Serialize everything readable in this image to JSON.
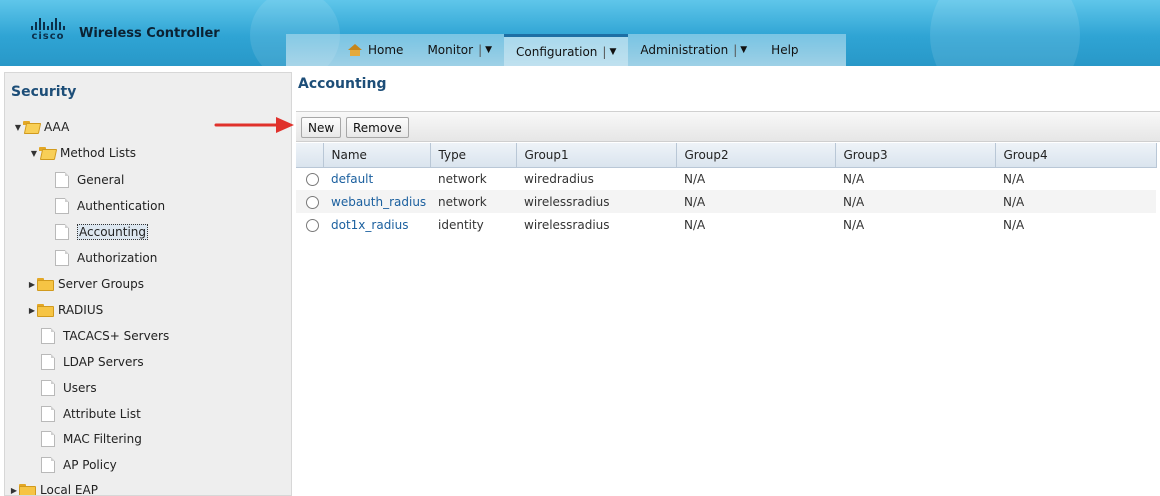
{
  "header": {
    "logo_text": "cisco",
    "product_name": "Wireless Controller",
    "nav": [
      {
        "label": "Home",
        "has_menu": false,
        "active": false
      },
      {
        "label": "Monitor",
        "has_menu": true,
        "active": false
      },
      {
        "label": "Configuration",
        "has_menu": true,
        "active": true
      },
      {
        "label": "Administration",
        "has_menu": true,
        "active": false
      },
      {
        "label": "Help",
        "has_menu": false,
        "active": false
      }
    ],
    "separator": "|",
    "dropdown_glyph": "▼"
  },
  "sidebar": {
    "title": "Security",
    "items": [
      {
        "label": "AAA",
        "type": "folder",
        "expanded": true
      },
      {
        "label": "Method Lists",
        "type": "folder",
        "expanded": true
      },
      {
        "label": "General",
        "type": "page"
      },
      {
        "label": "Authentication",
        "type": "page"
      },
      {
        "label": "Accounting",
        "type": "page",
        "selected": true
      },
      {
        "label": "Authorization",
        "type": "page"
      },
      {
        "label": "Server Groups",
        "type": "folder",
        "expanded": false
      },
      {
        "label": "RADIUS",
        "type": "folder",
        "expanded": false
      },
      {
        "label": "TACACS+ Servers",
        "type": "page"
      },
      {
        "label": "LDAP Servers",
        "type": "page"
      },
      {
        "label": "Users",
        "type": "page"
      },
      {
        "label": "Attribute List",
        "type": "page"
      },
      {
        "label": "MAC Filtering",
        "type": "page"
      },
      {
        "label": "AP Policy",
        "type": "page"
      },
      {
        "label": "Local EAP",
        "type": "folder",
        "expanded": false
      }
    ]
  },
  "main": {
    "title": "Accounting",
    "toolbar": {
      "new_label": "New",
      "remove_label": "Remove"
    },
    "table": {
      "columns": [
        "Name",
        "Type",
        "Group1",
        "Group2",
        "Group3",
        "Group4"
      ],
      "rows": [
        {
          "name": "default",
          "type": "network",
          "group1": "wiredradius",
          "group2": "N/A",
          "group3": "N/A",
          "group4": "N/A"
        },
        {
          "name": "webauth_radius",
          "type": "network",
          "group1": "wirelessradius",
          "group2": "N/A",
          "group3": "N/A",
          "group4": "N/A"
        },
        {
          "name": "dot1x_radius",
          "type": "identity",
          "group1": "wirelessradius",
          "group2": "N/A",
          "group3": "N/A",
          "group4": "N/A"
        }
      ]
    }
  },
  "colors": {
    "header_top": "#5fc6ea",
    "header_bottom": "#2898c8",
    "title_blue": "#1d4e78",
    "link_blue": "#1a5f9e",
    "annotation_arrow": "#e0312b"
  }
}
